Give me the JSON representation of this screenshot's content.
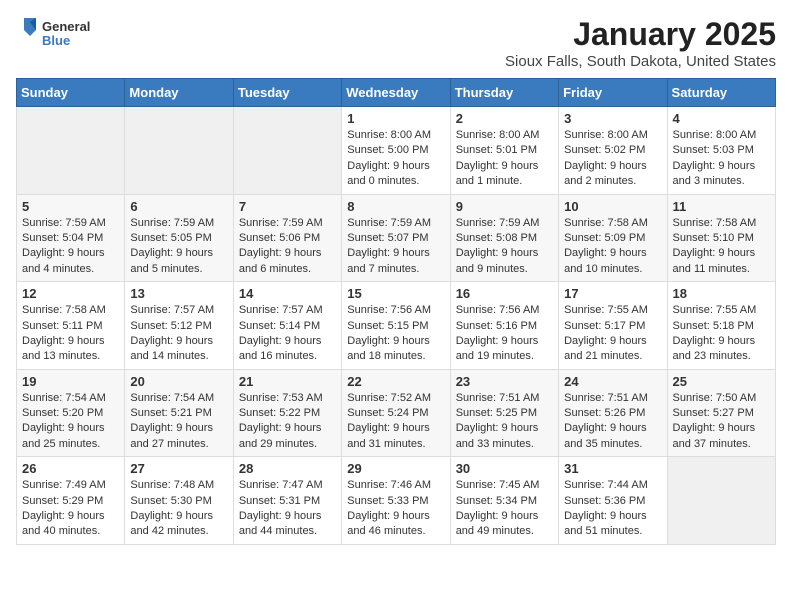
{
  "header": {
    "logo_general": "General",
    "logo_blue": "Blue",
    "month": "January 2025",
    "location": "Sioux Falls, South Dakota, United States"
  },
  "days_of_week": [
    "Sunday",
    "Monday",
    "Tuesday",
    "Wednesday",
    "Thursday",
    "Friday",
    "Saturday"
  ],
  "weeks": [
    [
      {
        "day": "",
        "info": ""
      },
      {
        "day": "",
        "info": ""
      },
      {
        "day": "",
        "info": ""
      },
      {
        "day": "1",
        "info": "Sunrise: 8:00 AM\nSunset: 5:00 PM\nDaylight: 9 hours\nand 0 minutes."
      },
      {
        "day": "2",
        "info": "Sunrise: 8:00 AM\nSunset: 5:01 PM\nDaylight: 9 hours\nand 1 minute."
      },
      {
        "day": "3",
        "info": "Sunrise: 8:00 AM\nSunset: 5:02 PM\nDaylight: 9 hours\nand 2 minutes."
      },
      {
        "day": "4",
        "info": "Sunrise: 8:00 AM\nSunset: 5:03 PM\nDaylight: 9 hours\nand 3 minutes."
      }
    ],
    [
      {
        "day": "5",
        "info": "Sunrise: 7:59 AM\nSunset: 5:04 PM\nDaylight: 9 hours\nand 4 minutes."
      },
      {
        "day": "6",
        "info": "Sunrise: 7:59 AM\nSunset: 5:05 PM\nDaylight: 9 hours\nand 5 minutes."
      },
      {
        "day": "7",
        "info": "Sunrise: 7:59 AM\nSunset: 5:06 PM\nDaylight: 9 hours\nand 6 minutes."
      },
      {
        "day": "8",
        "info": "Sunrise: 7:59 AM\nSunset: 5:07 PM\nDaylight: 9 hours\nand 7 minutes."
      },
      {
        "day": "9",
        "info": "Sunrise: 7:59 AM\nSunset: 5:08 PM\nDaylight: 9 hours\nand 9 minutes."
      },
      {
        "day": "10",
        "info": "Sunrise: 7:58 AM\nSunset: 5:09 PM\nDaylight: 9 hours\nand 10 minutes."
      },
      {
        "day": "11",
        "info": "Sunrise: 7:58 AM\nSunset: 5:10 PM\nDaylight: 9 hours\nand 11 minutes."
      }
    ],
    [
      {
        "day": "12",
        "info": "Sunrise: 7:58 AM\nSunset: 5:11 PM\nDaylight: 9 hours\nand 13 minutes."
      },
      {
        "day": "13",
        "info": "Sunrise: 7:57 AM\nSunset: 5:12 PM\nDaylight: 9 hours\nand 14 minutes."
      },
      {
        "day": "14",
        "info": "Sunrise: 7:57 AM\nSunset: 5:14 PM\nDaylight: 9 hours\nand 16 minutes."
      },
      {
        "day": "15",
        "info": "Sunrise: 7:56 AM\nSunset: 5:15 PM\nDaylight: 9 hours\nand 18 minutes."
      },
      {
        "day": "16",
        "info": "Sunrise: 7:56 AM\nSunset: 5:16 PM\nDaylight: 9 hours\nand 19 minutes."
      },
      {
        "day": "17",
        "info": "Sunrise: 7:55 AM\nSunset: 5:17 PM\nDaylight: 9 hours\nand 21 minutes."
      },
      {
        "day": "18",
        "info": "Sunrise: 7:55 AM\nSunset: 5:18 PM\nDaylight: 9 hours\nand 23 minutes."
      }
    ],
    [
      {
        "day": "19",
        "info": "Sunrise: 7:54 AM\nSunset: 5:20 PM\nDaylight: 9 hours\nand 25 minutes."
      },
      {
        "day": "20",
        "info": "Sunrise: 7:54 AM\nSunset: 5:21 PM\nDaylight: 9 hours\nand 27 minutes."
      },
      {
        "day": "21",
        "info": "Sunrise: 7:53 AM\nSunset: 5:22 PM\nDaylight: 9 hours\nand 29 minutes."
      },
      {
        "day": "22",
        "info": "Sunrise: 7:52 AM\nSunset: 5:24 PM\nDaylight: 9 hours\nand 31 minutes."
      },
      {
        "day": "23",
        "info": "Sunrise: 7:51 AM\nSunset: 5:25 PM\nDaylight: 9 hours\nand 33 minutes."
      },
      {
        "day": "24",
        "info": "Sunrise: 7:51 AM\nSunset: 5:26 PM\nDaylight: 9 hours\nand 35 minutes."
      },
      {
        "day": "25",
        "info": "Sunrise: 7:50 AM\nSunset: 5:27 PM\nDaylight: 9 hours\nand 37 minutes."
      }
    ],
    [
      {
        "day": "26",
        "info": "Sunrise: 7:49 AM\nSunset: 5:29 PM\nDaylight: 9 hours\nand 40 minutes."
      },
      {
        "day": "27",
        "info": "Sunrise: 7:48 AM\nSunset: 5:30 PM\nDaylight: 9 hours\nand 42 minutes."
      },
      {
        "day": "28",
        "info": "Sunrise: 7:47 AM\nSunset: 5:31 PM\nDaylight: 9 hours\nand 44 minutes."
      },
      {
        "day": "29",
        "info": "Sunrise: 7:46 AM\nSunset: 5:33 PM\nDaylight: 9 hours\nand 46 minutes."
      },
      {
        "day": "30",
        "info": "Sunrise: 7:45 AM\nSunset: 5:34 PM\nDaylight: 9 hours\nand 49 minutes."
      },
      {
        "day": "31",
        "info": "Sunrise: 7:44 AM\nSunset: 5:36 PM\nDaylight: 9 hours\nand 51 minutes."
      },
      {
        "day": "",
        "info": ""
      }
    ]
  ]
}
